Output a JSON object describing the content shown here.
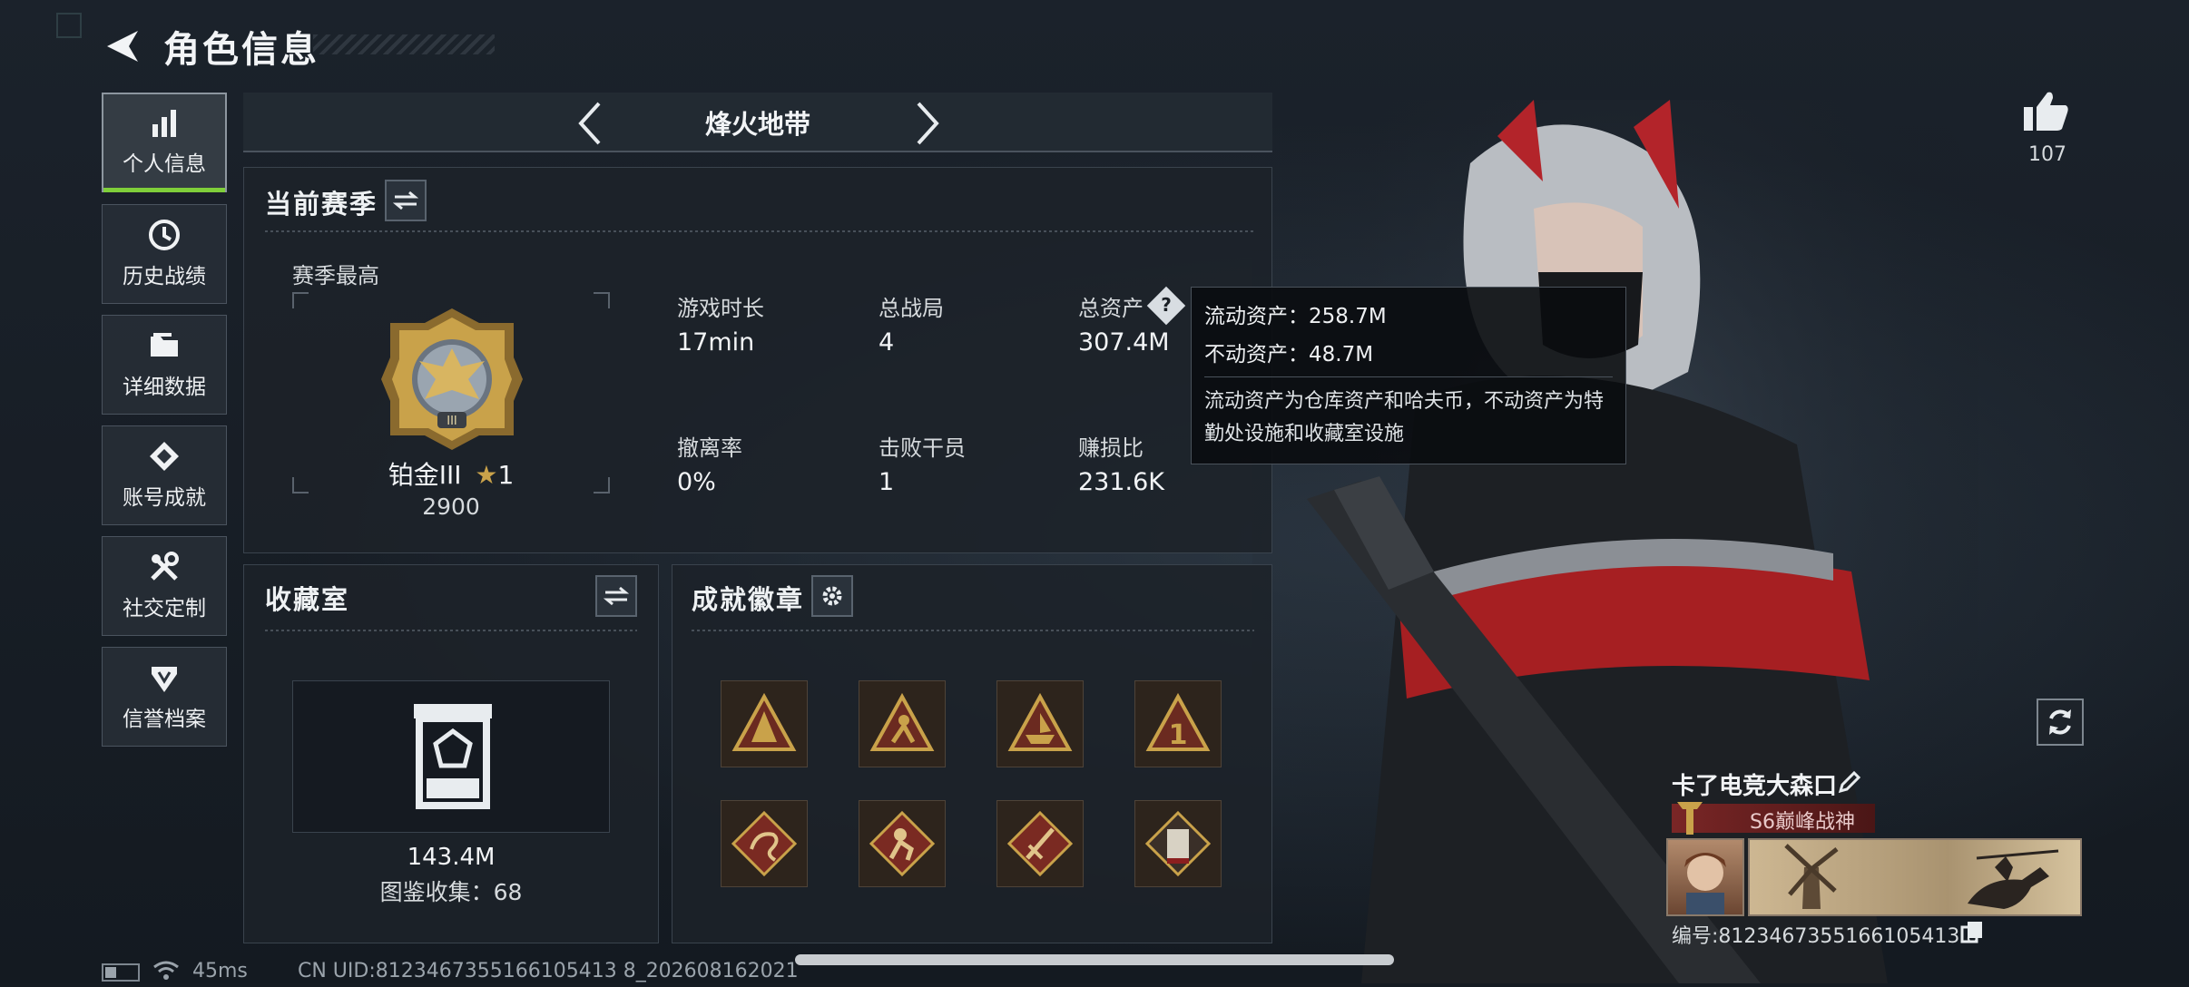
{
  "header": {
    "title": "角色信息"
  },
  "sidebar": {
    "items": [
      {
        "label": "个人信息",
        "icon": "bar-chart-icon",
        "active": true
      },
      {
        "label": "历史战绩",
        "icon": "history-clock-icon"
      },
      {
        "label": "详细数据",
        "icon": "folder-icon"
      },
      {
        "label": "账号成就",
        "icon": "achievement-icon"
      },
      {
        "label": "社交定制",
        "icon": "tools-icon"
      },
      {
        "label": "信誉档案",
        "icon": "shield-icon"
      }
    ]
  },
  "mode_selector": {
    "label": "烽火地带"
  },
  "season": {
    "title": "当前赛季",
    "best_label": "赛季最高",
    "rank_name": "铂金III",
    "rank_stars": "1",
    "rank_score": "2900",
    "stats": [
      {
        "label": "游戏时长",
        "value": "17min"
      },
      {
        "label": "总战局",
        "value": "4"
      },
      {
        "label": "总资产",
        "value": "307.4M"
      },
      {
        "label": "撤离率",
        "value": "0%"
      },
      {
        "label": "击败干员",
        "value": "1"
      },
      {
        "label": "赚损比",
        "value": "231.6K"
      }
    ]
  },
  "tooltip": {
    "liquid_label": "流动资产：",
    "liquid_value": "258.7M",
    "fixed_label": "不动资产：",
    "fixed_value": "48.7M",
    "description": "流动资产为仓库资产和哈夫币，不动资产为特勤处设施和收藏室设施"
  },
  "collection": {
    "title": "收藏室",
    "value": "143.4M",
    "catalog_label": "图鉴收集：",
    "catalog_count": "68"
  },
  "achievements": {
    "title": "成就徽章",
    "badges": [
      "triangle-badge-icon",
      "climber-badge-icon",
      "boat-badge-icon",
      "number-one-badge-icon",
      "dragon-badge-icon",
      "monkey-badge-icon",
      "sword-badge-icon",
      "s8-badge-icon"
    ]
  },
  "profile": {
    "likes": "107",
    "player_name": "卡了电竞大森口",
    "title_badge": "S6巅峰战神",
    "id_label": "编号:",
    "id_value": "8123467355166105413 8"
  },
  "footer": {
    "latency": "45ms",
    "uid_text": "CN UID:8123467355166105413 8_202608162021"
  },
  "colors": {
    "accent_green": "#7fcf3a",
    "title_badge_red": "#5a1c1c",
    "gold": "#c9a24a"
  }
}
